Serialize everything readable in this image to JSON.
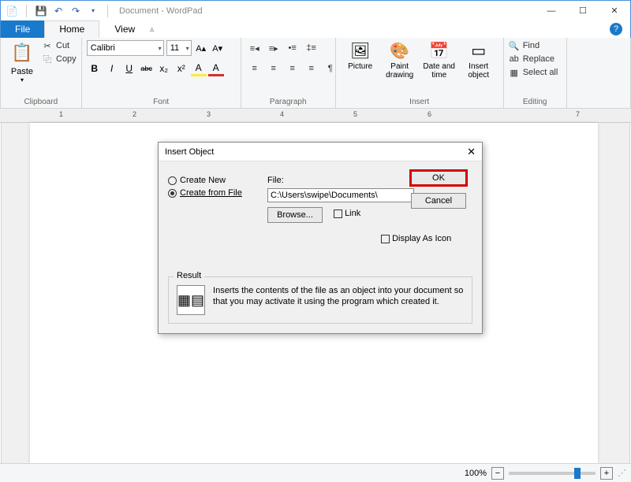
{
  "window": {
    "title": "Document - WordPad"
  },
  "qat": {
    "save": "💾",
    "undo": "↶",
    "redo": "↷"
  },
  "tabs": {
    "file": "File",
    "home": "Home",
    "view": "View"
  },
  "clipboard": {
    "paste": "Paste",
    "cut": "Cut",
    "copy": "Copy",
    "label": "Clipboard"
  },
  "font": {
    "name": "Calibri",
    "size": "11",
    "label": "Font",
    "bold": "B",
    "italic": "I",
    "underline": "U",
    "strike": "abc",
    "sub": "x₂",
    "sup": "x²",
    "highlight": "A",
    "color": "A"
  },
  "paragraph": {
    "label": "Paragraph"
  },
  "insert": {
    "picture": "Picture",
    "paint": "Paint drawing",
    "datetime": "Date and time",
    "object": "Insert object",
    "label": "Insert"
  },
  "editing": {
    "find": "Find",
    "replace": "Replace",
    "selectall": "Select all",
    "label": "Editing"
  },
  "ruler": {
    "marks": [
      "1",
      "2",
      "3",
      "4",
      "5",
      "6",
      "7"
    ]
  },
  "dialog": {
    "title": "Insert Object",
    "createNew": "Create New",
    "createFromFile": "Create from File",
    "fileLabel": "File:",
    "filePath": "C:\\Users\\swipe\\Documents\\",
    "browse": "Browse...",
    "link": "Link",
    "displayAsIcon": "Display As Icon",
    "ok": "OK",
    "cancel": "Cancel",
    "resultLabel": "Result",
    "resultText": "Inserts the contents of the file as an object into your document so that you may activate it using the program which created it."
  },
  "status": {
    "zoom": "100%",
    "minus": "−",
    "plus": "+"
  }
}
